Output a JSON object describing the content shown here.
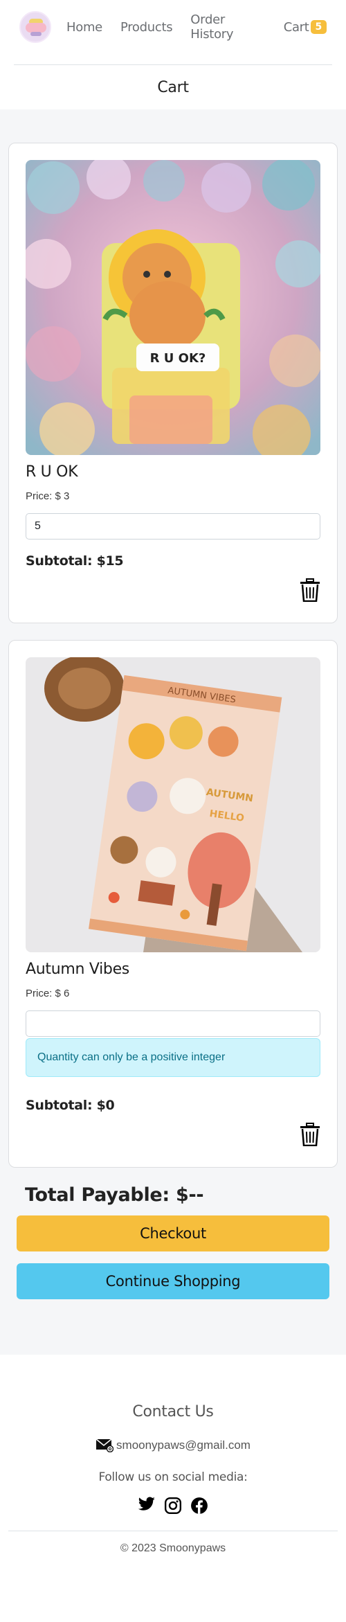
{
  "nav": {
    "links": [
      "Home",
      "Products",
      "Order History",
      "Cart"
    ],
    "cart_count": "5"
  },
  "page_title": "Cart",
  "items": [
    {
      "name": "R U OK",
      "price": "Price: $ 3",
      "quantity": "5",
      "subtotal": "Subtotal: $15",
      "image_caption": "R U OK?"
    },
    {
      "name": "Autumn Vibes",
      "price": "Price: $ 6",
      "quantity": "",
      "alert": "Quantity can only be a positive integer",
      "subtotal": "Subtotal: $0",
      "image_caption": "AUTUMN VIBES",
      "image_text_2": "AUTUMN",
      "image_text_3": "HELLO"
    }
  ],
  "total": "Total Payable: $--",
  "buttons": {
    "checkout": "Checkout",
    "continue": "Continue Shopping"
  },
  "footer": {
    "contact_title": "Contact Us",
    "email": "smoonypaws@gmail.com",
    "follow": "Follow us on social media:",
    "copyright": "© 2023 Smoonypaws"
  },
  "colors": {
    "accent_yellow": "#f6be3c",
    "accent_blue": "#54c8ee",
    "alert_bg": "#cff4fc"
  }
}
